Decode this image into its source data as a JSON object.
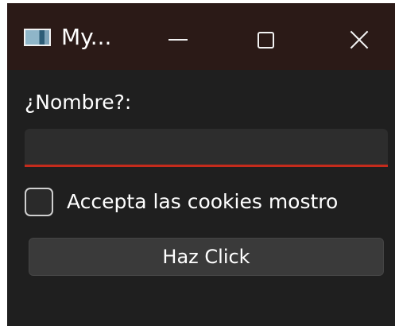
{
  "window": {
    "title": "My...",
    "icons": {
      "app": "app-window-icon",
      "minimize": "minimize-icon",
      "maximize": "maximize-icon",
      "close": "close-icon"
    }
  },
  "form": {
    "name_label": "¿Nombre?:",
    "name_value": "",
    "name_placeholder": "",
    "cookies_label": "Accepta las cookies mostro",
    "cookies_checked": false,
    "button_label": "Haz Click"
  },
  "colors": {
    "titlebar": "#2b1a17",
    "background": "#1f1f1f",
    "input_underline": "#c42b1c",
    "button": "#3a3a3a"
  }
}
